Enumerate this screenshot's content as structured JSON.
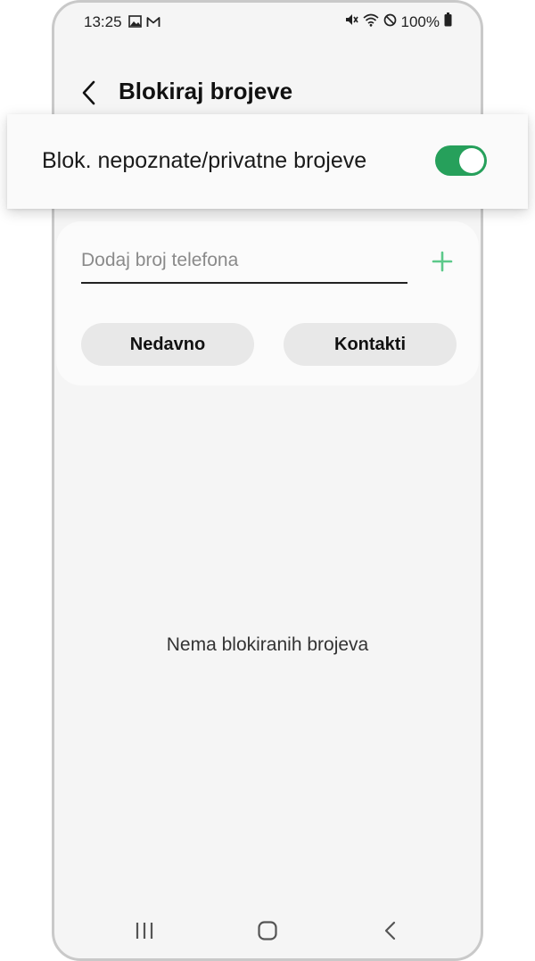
{
  "status_bar": {
    "time": "13:25",
    "battery": "100%",
    "left_icons": [
      "gallery-icon",
      "gmail-icon"
    ],
    "right_icons": [
      "mute-icon",
      "wifi-icon",
      "do-not-disturb-icon",
      "battery-icon"
    ]
  },
  "header": {
    "title": "Blokiraj brojeve",
    "back_icon": "chevron-left-icon"
  },
  "block_unknown": {
    "label": "Blok. nepoznate/privatne brojeve",
    "enabled": true,
    "toggle_color": "#26a05b"
  },
  "add_number": {
    "placeholder": "Dodaj broj telefona",
    "value": "",
    "add_icon": "plus-icon",
    "add_icon_color": "#5cc98a"
  },
  "buttons": {
    "recent": "Nedavno",
    "contacts": "Kontakti"
  },
  "empty_state": "Nema blokiranih brojeva",
  "nav_bar": {
    "icons": [
      "recents-icon",
      "home-icon",
      "back-icon"
    ]
  }
}
